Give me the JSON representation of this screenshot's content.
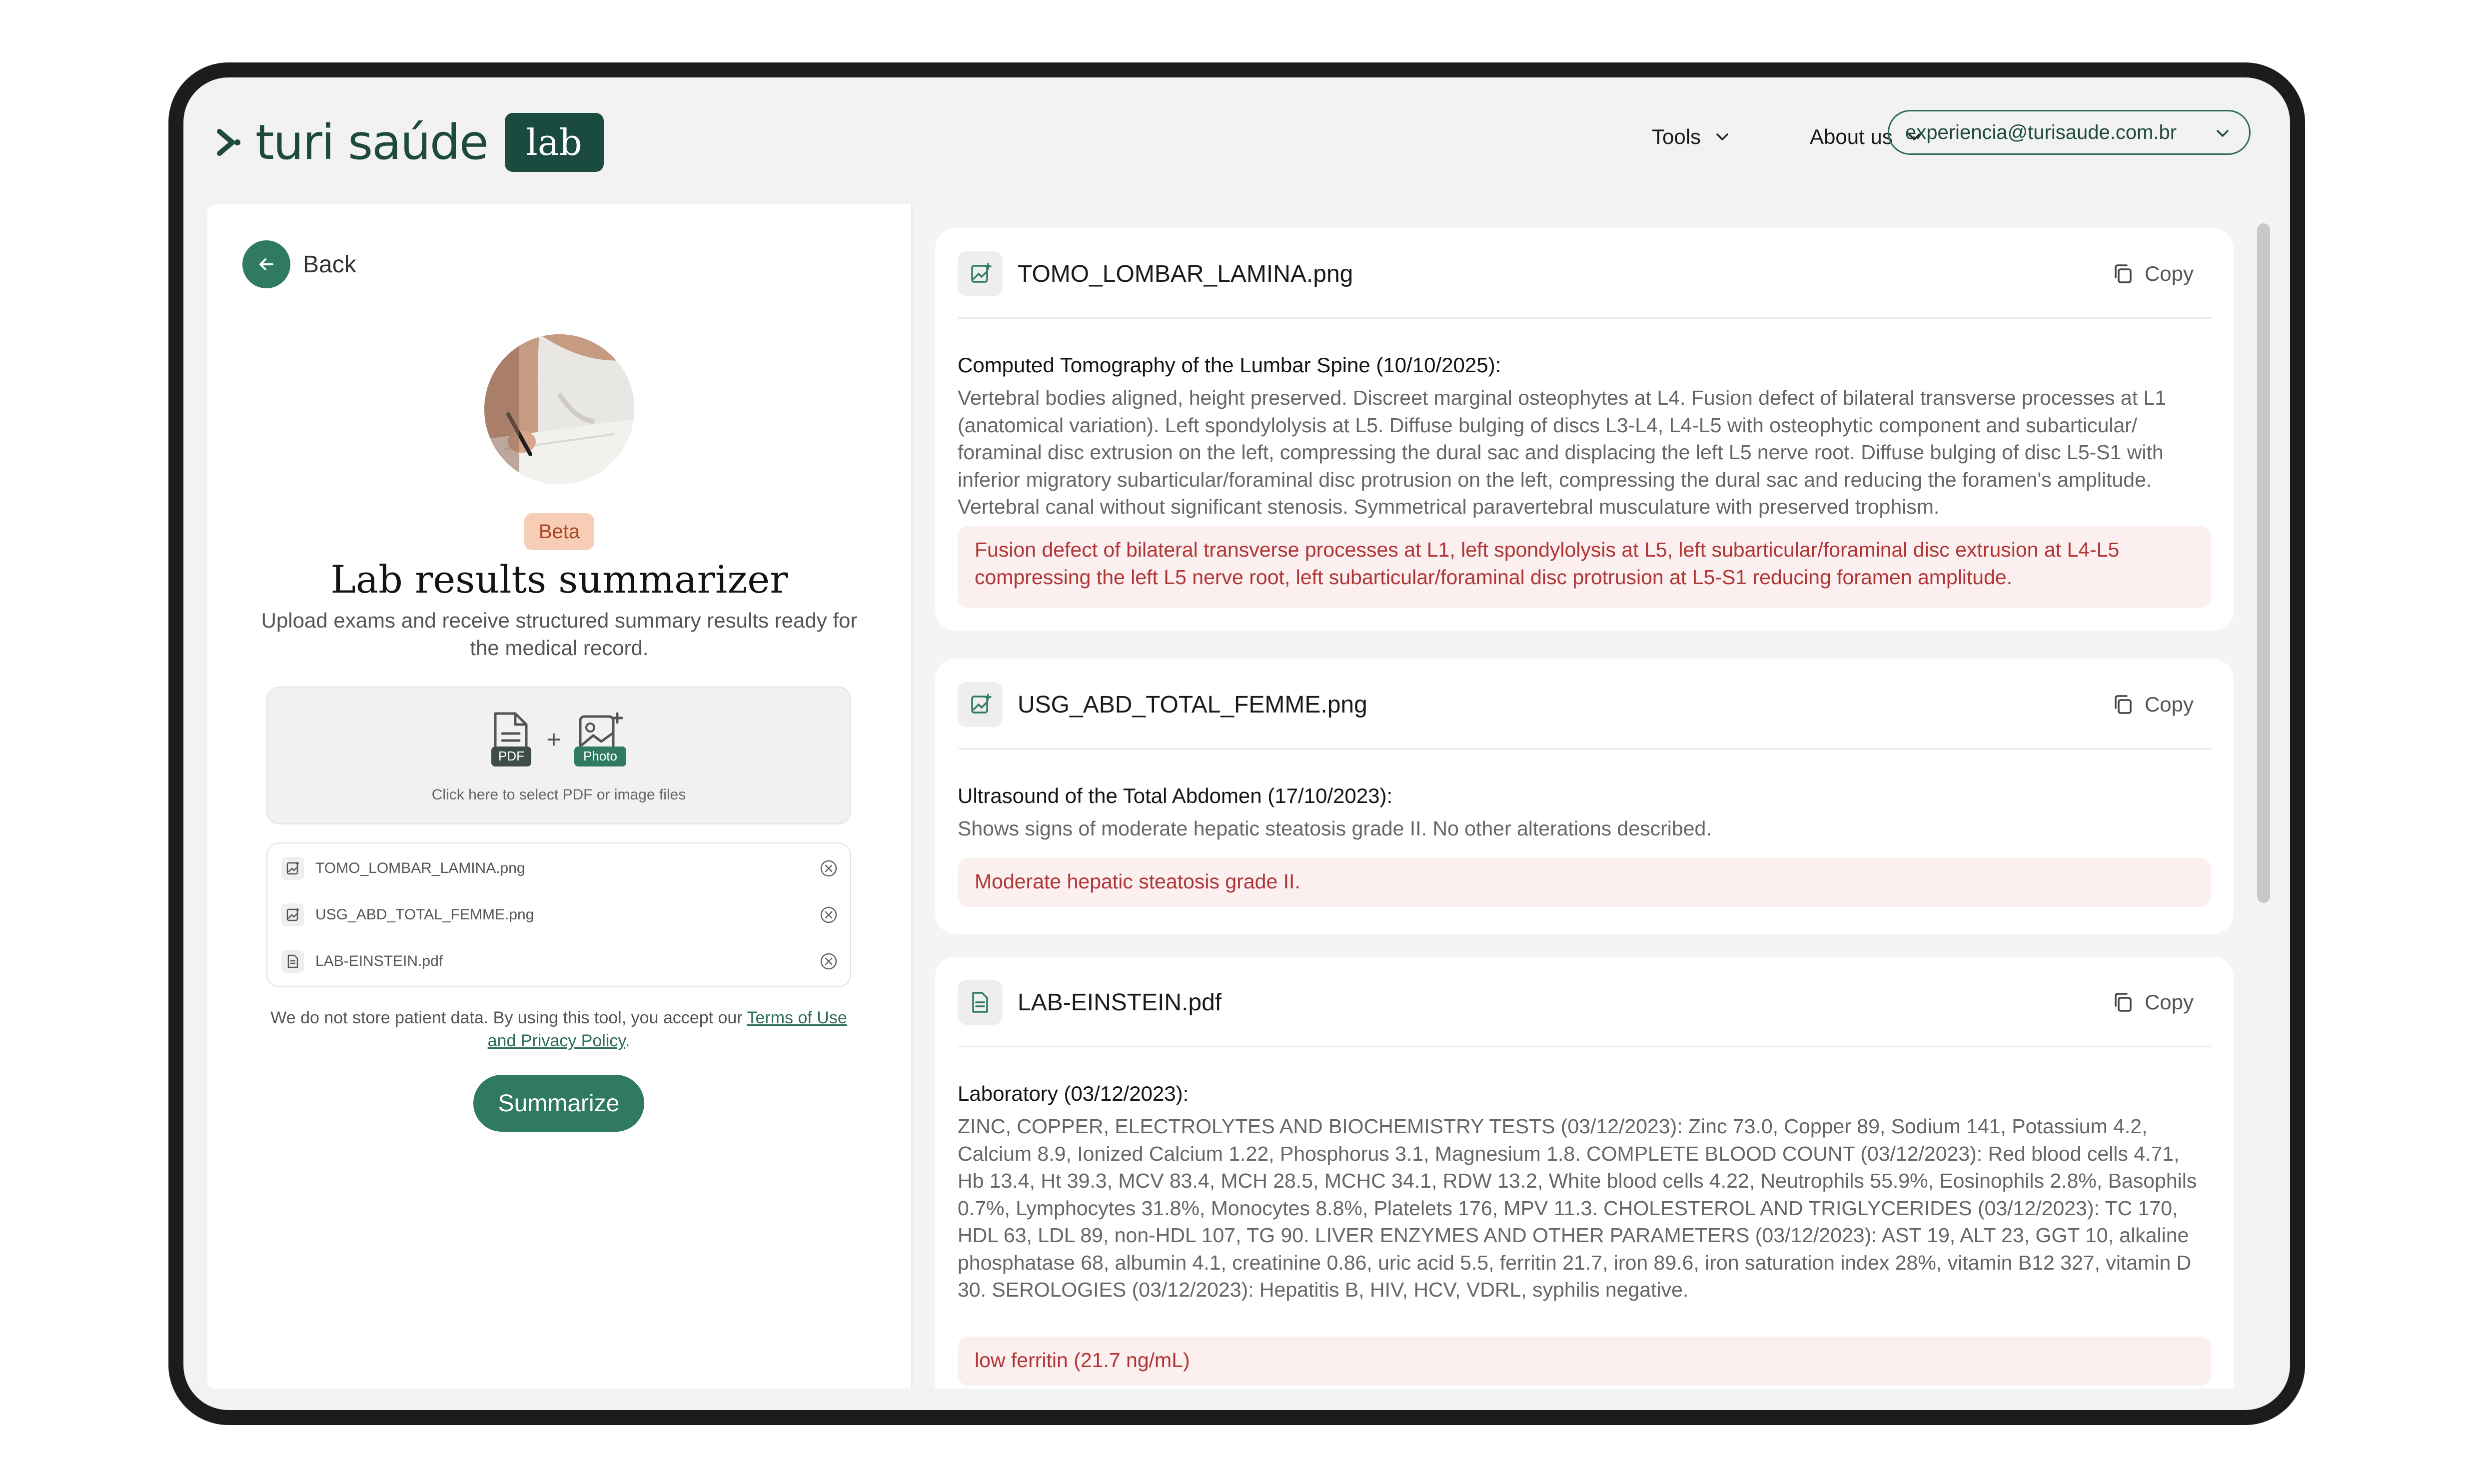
{
  "header": {
    "brand_name": "turi saúde",
    "brand_badge": "lab",
    "nav": [
      {
        "label": "Tools"
      },
      {
        "label": "About us"
      }
    ],
    "account_email": "experiencia@turisaude.com.br"
  },
  "left": {
    "back_label": "Back",
    "badge": "Beta",
    "title": "Lab results summarizer",
    "subtitle": "Upload exams and receive structured summary results ready for the medical record.",
    "upload": {
      "pdf_tag": "PDF",
      "photo_tag": "Photo",
      "plus": "+",
      "caption": "Click here to select PDF or image files"
    },
    "files": [
      {
        "name": "TOMO_LOMBAR_LAMINA.png",
        "icon": "image-file-icon"
      },
      {
        "name": "USG_ABD_TOTAL_FEMME.png",
        "icon": "image-file-icon"
      },
      {
        "name": "LAB-EINSTEIN.pdf",
        "icon": "pdf-file-icon"
      }
    ],
    "disclaimer_prefix": "We do not store patient data. By using this tool, you accept our ",
    "disclaimer_link": "Terms of Use and Privacy Policy",
    "disclaimer_suffix": ".",
    "summarize_label": "Summarize"
  },
  "results": [
    {
      "file": "TOMO_LOMBAR_LAMINA.png",
      "icon": "image-file-icon",
      "copy_label": "Copy",
      "heading": "Computed Tomography of the Lumbar Spine (10/10/2025):",
      "body": "Vertebral bodies aligned, height preserved. Discreet marginal osteophytes at L4. Fusion defect of bilateral transverse processes at L1 (anatomical variation). Left spondylolysis at L5. Diffuse bulging of discs L3-L4, L4-L5 with osteophytic component and subarticular/ foraminal disc extrusion on the left, compressing the dural sac and displacing the left L5 nerve root. Diffuse bulging of disc L5-S1 with inferior migratory subarticular/foraminal disc protrusion on the left, compressing the dural sac and reducing the foramen's amplitude. Vertebral canal without significant stenosis. Symmetrical paravertebral musculature with preserved trophism.",
      "highlight": "Fusion defect of bilateral transverse processes at L1, left spondylolysis at L5, left subarticular/foraminal disc extrusion at L4-L5 compressing the left L5 nerve root, left subarticular/foraminal disc protrusion at L5-S1 reducing foramen amplitude."
    },
    {
      "file": "USG_ABD_TOTAL_FEMME.png",
      "icon": "image-file-icon",
      "copy_label": "Copy",
      "heading": "Ultrasound of the Total Abdomen (17/10/2023):",
      "body": "Shows signs of moderate hepatic steatosis grade II. No other alterations described.",
      "highlight": "Moderate hepatic steatosis grade II."
    },
    {
      "file": "LAB-EINSTEIN.pdf",
      "icon": "pdf-file-icon",
      "copy_label": "Copy",
      "heading": "Laboratory (03/12/2023):",
      "body": "ZINC, COPPER, ELECTROLYTES AND BIOCHEMISTRY TESTS (03/12/2023): Zinc 73.0, Copper 89, Sodium 141, Potassium 4.2, Calcium 8.9, Ionized Calcium 1.22, Phosphorus 3.1, Magnesium 1.8. COMPLETE BLOOD COUNT (03/12/2023): Red blood cells 4.71, Hb 13.4, Ht 39.3, MCV 83.4, MCH 28.5, MCHC 34.1, RDW 13.2, White blood cells 4.22, Neutrophils 55.9%, Eosinophils 2.8%, Basophils 0.7%, Lymphocytes 31.8%, Monocytes 8.8%, Platelets 176, MPV 11.3. CHOLESTEROL AND TRIGLYCERIDES (03/12/2023): TC 170, HDL 63, LDL 89, non-HDL 107, TG 90. LIVER ENZYMES AND OTHER PARAMETERS (03/12/2023): AST 19, ALT 23, GGT 10, alkaline phosphatase 68, albumin 4.1, creatinine 0.86, uric acid 5.5, ferritin 21.7, iron 89.6, iron saturation index 28%, vitamin B12 327, vitamin D 30. SEROLOGIES (03/12/2023): Hepatitis B, HIV, HCV, VDRL, syphilis negative.",
      "highlight": "low ferritin (21.7 ng/mL)"
    }
  ],
  "colors": {
    "brand_dark": "#1b4a3e",
    "brand": "#2f7a60",
    "beta_bg": "#f7cdb6",
    "alert_bg": "#fbefef",
    "alert_text": "#b03535"
  }
}
